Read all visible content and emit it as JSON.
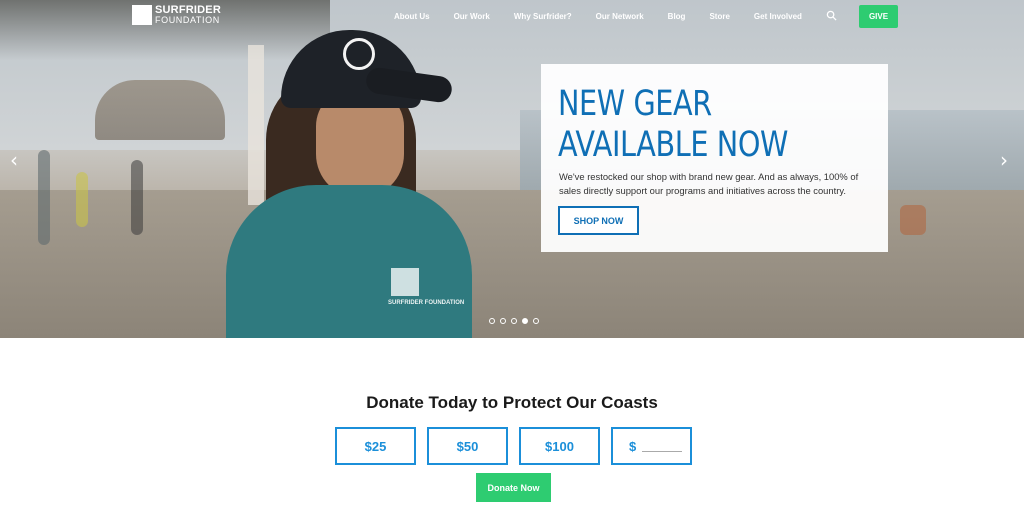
{
  "brand": {
    "logo_top": "SURFRIDER",
    "logo_bottom": "FOUNDATION",
    "accent_blue": "#0f6fb5",
    "accent_green": "#2ecc71"
  },
  "nav": {
    "items": [
      "About Us",
      "Our Work",
      "Why Surfrider?",
      "Our Network",
      "Blog",
      "Store",
      "Get Involved"
    ],
    "search_icon": "search-icon",
    "give_label": "GIVE"
  },
  "hero": {
    "title": "NEW GEAR AVAILABLE NOW",
    "body": "We've restocked our shop with brand new gear. And as always, 100% of sales directly support our programs and initiatives across the country.",
    "cta_label": "SHOP NOW",
    "prev_icon": "chevron-left-icon",
    "next_icon": "chevron-right-icon",
    "sweater_text": "SURFRIDER FOUNDATION",
    "slides_total": 5,
    "active_slide": 4
  },
  "donate": {
    "title": "Donate Today to Protect Our Coasts",
    "amounts": [
      "$25",
      "$50",
      "$100"
    ],
    "custom_prefix": "$",
    "button_label": "Donate Now"
  }
}
